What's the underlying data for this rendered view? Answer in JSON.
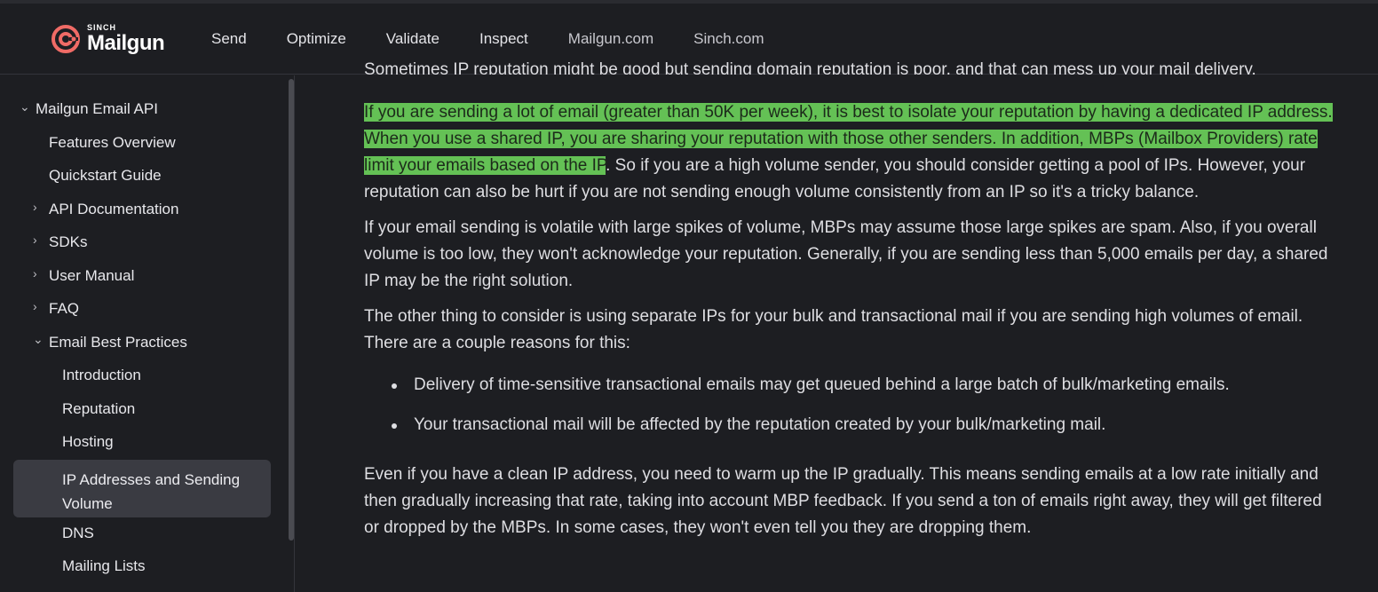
{
  "brand": {
    "sinch": "SINCH",
    "name": "Mailgun",
    "accent": "#f06b66"
  },
  "nav": {
    "items": [
      "Send",
      "Optimize",
      "Validate",
      "Inspect",
      "Mailgun.com",
      "Sinch.com"
    ]
  },
  "sidebar": {
    "root": "Mailgun Email API",
    "features": "Features Overview",
    "quickstart": "Quickstart Guide",
    "api_docs": "API Documentation",
    "sdks": "SDKs",
    "user_manual": "User Manual",
    "faq": "FAQ",
    "best_practices": "Email Best Practices",
    "introduction": "Introduction",
    "reputation": "Reputation",
    "hosting": "Hosting",
    "ip_addresses": "IP Addresses and Sending Volume",
    "dns": "DNS",
    "mailing_lists": "Mailing Lists"
  },
  "content": {
    "partial_top": "Sometimes IP reputation might be good but sending domain reputation is poor, and that can mess up your mail delivery.",
    "p1_highlight": "If you are sending a lot of email (greater than 50K per week), it is best to isolate your reputation by having a dedicated IP address. When you use a shared IP, you are sharing your reputation with those other senders. In addition, MBPs (Mailbox Providers) rate limit your emails based on the IP",
    "p1_rest": ". So if you are a high volume sender, you should consider getting a pool of IPs. However, your reputation can also be hurt if you are not sending enough volume consistently from an IP so it's a tricky balance.",
    "p2": "If your email sending is volatile with large spikes of volume, MBPs may assume those large spikes are spam. Also, if you overall volume is too low, they won't acknowledge your reputation. Generally, if you are sending less than 5,000 emails per day, a shared IP may be the right solution.",
    "p3": "The other thing to consider is using separate IPs for your bulk and transactional mail if you are sending high volumes of email. There are a couple reasons for this:",
    "bullets": [
      "Delivery of time-sensitive transactional emails may get queued behind a large batch of bulk/marketing emails.",
      "Your transactional mail will be affected by the reputation created by your bulk/marketing mail."
    ],
    "p4": "Even if you have a clean IP address, you need to warm up the IP gradually. This means sending emails at a low rate initially and then gradually increasing that rate, taking into account MBP feedback. If you send a ton of emails right away, they will get filtered or dropped by the MBPs. In some cases, they won't even tell you they are dropping them."
  },
  "colors": {
    "background": "#1d1e22",
    "highlight": "#64c155",
    "active_item": "#3a3b42"
  }
}
